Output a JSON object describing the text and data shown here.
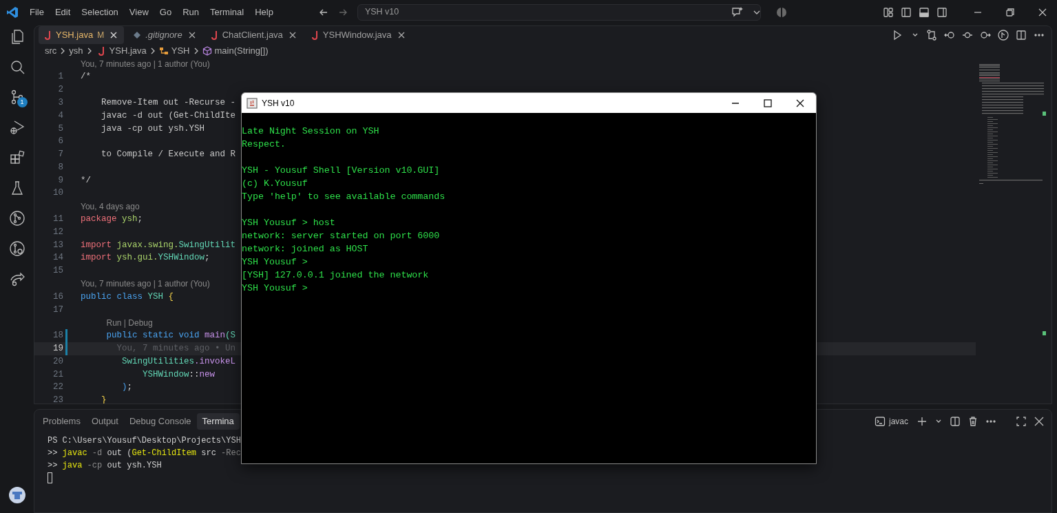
{
  "title_bar": {
    "menu": [
      "File",
      "Edit",
      "Selection",
      "View",
      "Go",
      "Run",
      "Terminal",
      "Help"
    ],
    "command_center": "YSH v10"
  },
  "activity_bar": {
    "source_control_badge": "1"
  },
  "editor_tabs": [
    {
      "label": "YSH.java",
      "kind": "java",
      "status": "M",
      "selected": true,
      "preview": false
    },
    {
      "label": ".gitignore",
      "kind": "git",
      "selected": false,
      "preview": true
    },
    {
      "label": "ChatClient.java",
      "kind": "java",
      "selected": false,
      "preview": false
    },
    {
      "label": "YSHWindow.java",
      "kind": "java",
      "selected": false,
      "preview": false
    }
  ],
  "breadcrumb": [
    {
      "text": "src",
      "kind": "folder"
    },
    {
      "text": "ysh",
      "kind": "folder"
    },
    {
      "text": "YSH.java",
      "kind": "java"
    },
    {
      "text": "YSH",
      "kind": "class"
    },
    {
      "text": "main(String[])",
      "kind": "method"
    }
  ],
  "code_lines": [
    {
      "kind": "lens",
      "text": "You, 7 minutes ago | 1 author (You)"
    },
    {
      "kind": "line",
      "number": "1",
      "current": false,
      "changed": false,
      "tokens": [
        {
          "text": "/*",
          "kind": "plain"
        }
      ]
    },
    {
      "kind": "line",
      "number": "2",
      "current": false,
      "changed": false
    },
    {
      "kind": "line",
      "number": "3",
      "current": false,
      "changed": false,
      "tokens": [
        {
          "text": "    Remove-Item out -Recurse -",
          "kind": "plain"
        }
      ]
    },
    {
      "kind": "line",
      "number": "4",
      "current": false,
      "changed": false,
      "tokens": [
        {
          "text": "    javac -d out (Get-ChildIte",
          "kind": "plain"
        }
      ]
    },
    {
      "kind": "line",
      "number": "5",
      "current": false,
      "changed": false,
      "tokens": [
        {
          "text": "    java -cp out ysh.YSH",
          "kind": "plain"
        }
      ]
    },
    {
      "kind": "line",
      "number": "6",
      "current": false,
      "changed": false
    },
    {
      "kind": "line",
      "number": "7",
      "current": false,
      "changed": false,
      "tokens": [
        {
          "text": "    to Compile / Execute and R",
          "kind": "plain"
        }
      ]
    },
    {
      "kind": "line",
      "number": "8",
      "current": false,
      "changed": false
    },
    {
      "kind": "line",
      "number": "9",
      "current": false,
      "changed": false,
      "tokens": [
        {
          "text": "*/",
          "kind": "plain"
        }
      ]
    },
    {
      "kind": "line",
      "number": "10",
      "current": false,
      "changed": false
    },
    {
      "kind": "lens",
      "text": "You, 4 days ago"
    },
    {
      "kind": "line",
      "number": "11",
      "current": false,
      "changed": false,
      "tokens": [
        {
          "text": "package",
          "kind": "keyword"
        },
        {
          "text": " ysh",
          "kind": "ident"
        },
        {
          "text": ";",
          "kind": "punct"
        }
      ]
    },
    {
      "kind": "line",
      "number": "12",
      "current": false,
      "changed": false
    },
    {
      "kind": "line",
      "number": "13",
      "current": false,
      "changed": false,
      "tokens": [
        {
          "text": "import",
          "kind": "keyword"
        },
        {
          "text": " javax.swing.",
          "kind": "ident"
        },
        {
          "text": "SwingUtilit",
          "kind": "type"
        }
      ]
    },
    {
      "kind": "line",
      "number": "14",
      "current": false,
      "changed": false,
      "tokens": [
        {
          "text": "import",
          "kind": "keyword"
        },
        {
          "text": " ysh.gui.",
          "kind": "ident"
        },
        {
          "text": "YSHWindow",
          "kind": "type"
        },
        {
          "text": ";",
          "kind": "punct"
        }
      ]
    },
    {
      "kind": "line",
      "number": "15",
      "current": false,
      "changed": false
    },
    {
      "kind": "lens",
      "text": "You, 7 minutes ago | 1 author (You)"
    },
    {
      "kind": "line",
      "number": "16",
      "current": false,
      "changed": false,
      "tokens": [
        {
          "text": "public class",
          "kind": "modifier"
        },
        {
          "text": " YSH ",
          "kind": "type"
        },
        {
          "text": "{",
          "kind": "brace"
        }
      ]
    },
    {
      "kind": "line",
      "number": "17",
      "current": false,
      "changed": false
    },
    {
      "kind": "lens",
      "text": "Run | Debug"
    },
    {
      "kind": "line",
      "number": "18",
      "current": false,
      "changed": true,
      "tokens": [
        {
          "text": "     public static void",
          "kind": "modifier"
        },
        {
          "text": " main",
          "kind": "func"
        },
        {
          "text": "(S",
          "kind": "type"
        }
      ]
    },
    {
      "kind": "line",
      "number": "19",
      "current": true,
      "changed": true,
      "tokens": [
        {
          "text": "       You, 7 minutes ago • Un",
          "kind": "ghost"
        }
      ]
    },
    {
      "kind": "line",
      "number": "20",
      "current": false,
      "changed": false,
      "tokens": [
        {
          "text": "        SwingUtilities",
          "kind": "type"
        },
        {
          "text": ".invokeL",
          "kind": "func"
        }
      ]
    },
    {
      "kind": "line",
      "number": "21",
      "current": false,
      "changed": false,
      "tokens": [
        {
          "text": "            YSHWindow",
          "kind": "type"
        },
        {
          "text": "::",
          "kind": "punct"
        },
        {
          "text": "new",
          "kind": "func"
        }
      ]
    },
    {
      "kind": "line",
      "number": "22",
      "current": false,
      "changed": false,
      "tokens": [
        {
          "text": "        )",
          "kind": "modifier"
        },
        {
          "text": ";",
          "kind": "punct"
        }
      ]
    },
    {
      "kind": "line",
      "number": "23",
      "current": false,
      "changed": false,
      "tokens": [
        {
          "text": "    }",
          "kind": "brace"
        }
      ]
    }
  ],
  "panel": {
    "tabs": [
      {
        "label": "Problems",
        "selected": false
      },
      {
        "label": "Output",
        "selected": false
      },
      {
        "label": "Debug Console",
        "selected": false
      },
      {
        "label": "Termina",
        "selected": true
      }
    ],
    "terminal_name": "javac",
    "terminal_lines": [
      [
        {
          "text": "PS C:\\Users\\Yousuf\\Desktop\\Projects\\YSH",
          "kind": "plain"
        }
      ],
      [
        {
          "text": ">> ",
          "kind": "plain"
        },
        {
          "text": "javac",
          "kind": "command"
        },
        {
          "text": " -d",
          "kind": "flag"
        },
        {
          "text": " out (",
          "kind": "plain"
        },
        {
          "text": "Get-ChildItem",
          "kind": "command"
        },
        {
          "text": " src ",
          "kind": "plain"
        },
        {
          "text": "-Rec",
          "kind": "flag"
        }
      ],
      [
        {
          "text": ">> ",
          "kind": "plain"
        },
        {
          "text": "java",
          "kind": "command"
        },
        {
          "text": " -cp",
          "kind": "flag"
        },
        {
          "text": " out ysh.YSH",
          "kind": "plain"
        }
      ]
    ]
  },
  "app_window": {
    "title": "YSH v10",
    "output_blocks": [
      [
        "Late Night Session on YSH",
        "Respect."
      ],
      [
        "YSH - Yousuf Shell [Version v10.GUI]",
        "(c) K.Yousuf",
        "Type 'help' to see available commands"
      ],
      [
        "YSH Yousuf > host",
        "network: server started on port 6000",
        "network: joined as HOST",
        "YSH Yousuf >",
        "[YSH] 127.0.0.1 joined the network",
        "YSH Yousuf >"
      ]
    ]
  }
}
